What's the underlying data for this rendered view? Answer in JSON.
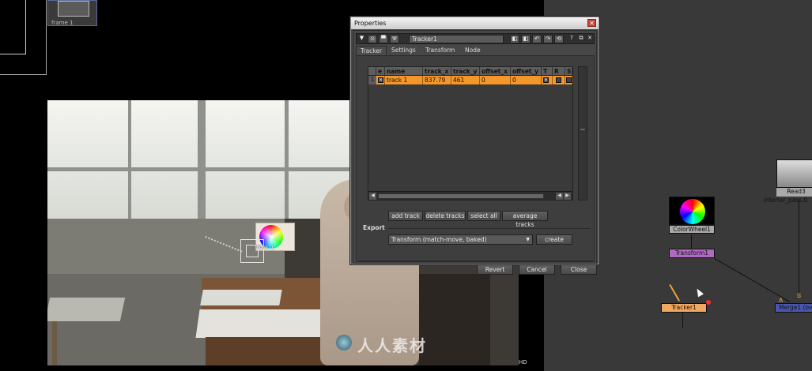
{
  "viewer": {
    "thumb_label": "frame 1",
    "track_label": "track 1",
    "format_label": "HD",
    "watermark": "人人素材"
  },
  "properties": {
    "title": "Properties",
    "close_glyph": "✕",
    "node_name": "Tracker1",
    "tabs": [
      "Tracker",
      "Settings",
      "Transform",
      "Node"
    ],
    "active_tab": "Tracker",
    "table": {
      "columns": [
        "",
        "e",
        "name",
        "track_x",
        "track_y",
        "offset_x",
        "offset_y",
        "T",
        "R",
        "S"
      ],
      "rows": [
        {
          "index": "1",
          "enabled": true,
          "name": "track 1",
          "track_x": "837.79",
          "track_y": "461",
          "offset_x": "0",
          "offset_y": "0",
          "T": true,
          "R": false,
          "S": false
        }
      ]
    },
    "buttons": {
      "add_track": "add track",
      "delete_tracks": "delete tracks",
      "select_all": "select all",
      "average_tracks": "average tracks",
      "create": "create",
      "revert": "Revert",
      "cancel": "Cancel",
      "close": "Close"
    },
    "export": {
      "label": "Export",
      "selected": "Transform (match-move, baked)"
    }
  },
  "nodegraph": {
    "nodes": {
      "read3": {
        "label": "Read3",
        "sublabel": "interior_pass.0"
      },
      "colorwheel": {
        "label": "ColorWheel1"
      },
      "transform": {
        "label": "Transform1"
      },
      "tracker": {
        "label": "Tracker1"
      },
      "merge": {
        "label": "Merge1 (ov"
      }
    },
    "pipe_labels": {
      "a": "A",
      "b": "B"
    },
    "colors": {
      "transform": "#b06ac0",
      "tracker": "#f0a860",
      "merge": "#4a56b0",
      "table_row": "#f4962a"
    }
  }
}
